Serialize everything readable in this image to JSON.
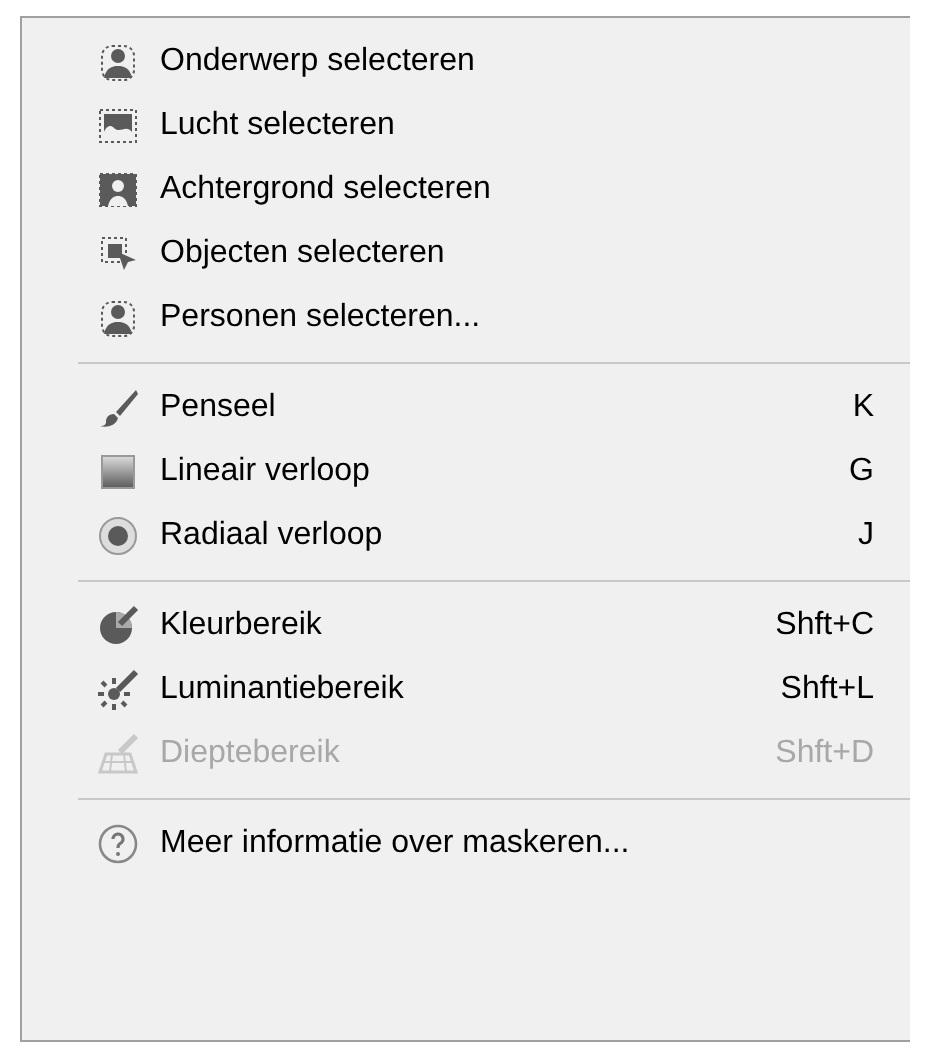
{
  "menu": {
    "groups": [
      {
        "items": [
          {
            "kind": "subject",
            "label": "Onderwerp selecteren",
            "disabled": false
          },
          {
            "kind": "sky",
            "label": "Lucht selecteren",
            "disabled": false
          },
          {
            "kind": "background",
            "label": "Achtergrond selecteren",
            "disabled": false
          },
          {
            "kind": "objects",
            "label": "Objecten selecteren",
            "disabled": false
          },
          {
            "kind": "subject",
            "label": "Personen selecteren...",
            "disabled": false
          }
        ]
      },
      {
        "items": [
          {
            "kind": "brush",
            "label": "Penseel",
            "shortcut": "K",
            "disabled": false
          },
          {
            "kind": "linear",
            "label": "Lineair verloop",
            "shortcut": "G",
            "disabled": false
          },
          {
            "kind": "radial",
            "label": "Radiaal verloop",
            "shortcut": "J",
            "disabled": false
          }
        ]
      },
      {
        "items": [
          {
            "kind": "color",
            "label": "Kleurbereik",
            "shortcut": "Shft+C",
            "disabled": false
          },
          {
            "kind": "luminance",
            "label": "Luminantiebereik",
            "shortcut": "Shft+L",
            "disabled": false
          },
          {
            "kind": "depth",
            "label": "Dieptebereik",
            "shortcut": "Shft+D",
            "disabled": true
          }
        ]
      },
      {
        "items": [
          {
            "kind": "help",
            "label": "Meer informatie over maskeren...",
            "disabled": false
          }
        ]
      }
    ]
  }
}
